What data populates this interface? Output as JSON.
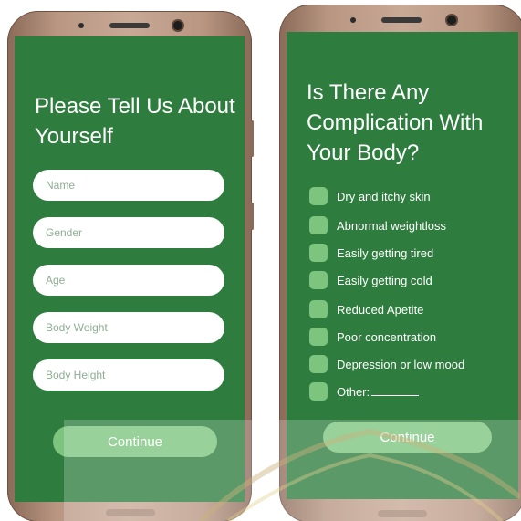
{
  "left_screen": {
    "title": "Please Tell Us About Yourself",
    "fields": [
      {
        "placeholder": "Name"
      },
      {
        "placeholder": "Gender"
      },
      {
        "placeholder": "Age"
      },
      {
        "placeholder": "Body Weight"
      },
      {
        "placeholder": "Body Height"
      }
    ],
    "continue_label": "Continue"
  },
  "right_screen": {
    "title": "Is There Any Complication With Your Body?",
    "options": [
      {
        "label": "Dry and itchy skin"
      },
      {
        "label": "Abnormal weightloss"
      },
      {
        "label": "Easily getting tired"
      },
      {
        "label": "Easily getting cold"
      },
      {
        "label": "Reduced Apetite"
      },
      {
        "label": "Poor concentration"
      },
      {
        "label": "Depression or low mood"
      },
      {
        "label": "Other:"
      }
    ],
    "continue_label": "Continue"
  },
  "colors": {
    "screen_bg": "#2e7d3e",
    "accent": "#7dc47f",
    "phone_frame": "#b89682"
  }
}
